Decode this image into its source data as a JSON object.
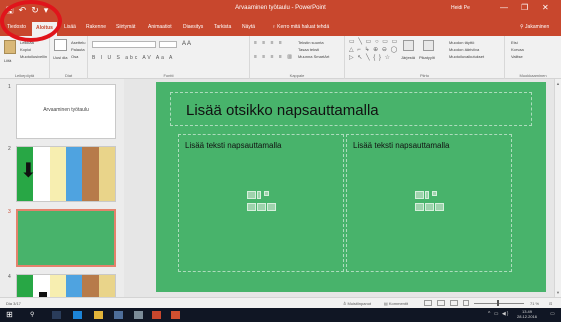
{
  "window": {
    "title": "Arvaaminen työtaulu - PowerPoint",
    "user": "Heidi Pe",
    "minimize": "—",
    "restore": "❐",
    "close": "✕"
  },
  "qat": {
    "save": "🖫",
    "undo": "↶",
    "redo": "↻",
    "customize": "▾"
  },
  "tabs": [
    {
      "label": "Tiedosto",
      "active": false
    },
    {
      "label": "Aloitus",
      "active": true
    },
    {
      "label": "Lisää",
      "active": false
    },
    {
      "label": "Rakenne",
      "active": false
    },
    {
      "label": "Siirtymät",
      "active": false
    },
    {
      "label": "Animaatiot",
      "active": false
    },
    {
      "label": "Diaesitys",
      "active": false
    },
    {
      "label": "Tarkista",
      "active": false
    },
    {
      "label": "Näytä",
      "active": false
    }
  ],
  "tell_me": "♀ Kerro mitä haluat tehdä",
  "sign_in": "⚲ Jakaminen",
  "ribbon": {
    "groups": {
      "clipboard": "Leikepöytä",
      "slides": "Diat",
      "font": "Fontti",
      "paragraph": "Kappale",
      "drawing": "Piirto",
      "editing": "Muokkaaminen"
    },
    "clipboard": {
      "paste": "Liitä",
      "cut": "Leikkaa",
      "copy": "Kopioi",
      "format_painter": "Muotoilusivellin"
    },
    "slides": {
      "new_slide": "Uusi dia",
      "layout": "Asettelu",
      "reset": "Palauta",
      "section": "Osa"
    },
    "font": {
      "name": "",
      "size": "",
      "format_row": "B I U S abc AV Aa A"
    },
    "paragraph": {
      "row1": "≡ ≡ ≡ ≡",
      "row2": "≡ ≡ ≡ ≡ ▥",
      "text_direction": "Tekstin suunta",
      "align_text": "Tasaa teksti",
      "smartart": "Muunna SmartArt"
    },
    "drawing": {
      "shapes_row1": "▭ ╲ ▭ ○ ▭ ▭",
      "shapes_row2": "△ ⌐ ↳ ⊕ ⊖ ◯",
      "shapes_row3": "▷ ↖ ╲ { } ☆",
      "arrange": "Järjestä",
      "quick_styles": "Pikatyylit",
      "fill": "Muodon täyttö",
      "outline": "Muodon ääriviiva",
      "effects": "Muotoiluvaikutukset"
    },
    "editing": {
      "find": "Etsi",
      "replace": "Korvaa",
      "select": "Valitse"
    }
  },
  "thumbnails": {
    "numbers": [
      "1",
      "2",
      "3",
      "4"
    ],
    "slide1_text": "Arvaaminen työtaulu",
    "stripe_colors": [
      "#28a745",
      "#ffffff",
      "#f7eeb0",
      "#4fa3e0",
      "#b77b4a",
      "#e9d48a"
    ]
  },
  "slide": {
    "title_placeholder": "Lisää otsikko napsauttamalla",
    "left_placeholder": "Lisää teksti napsauttamalla",
    "right_placeholder": "Lisää teksti napsauttamalla",
    "background": "#48b36b"
  },
  "status": {
    "slide_counter": "Dia 3/17",
    "notes": "≙ Muistiinpanot",
    "comments": "▤ Kommentit",
    "zoom": "71 %"
  },
  "taskbar": {
    "start": "⊞",
    "search": "⚲",
    "time": "13.49",
    "date": "28.12.2016"
  },
  "colors": {
    "accent": "#c8472d",
    "highlight": "#e0141b",
    "slide_green": "#48b36b"
  }
}
